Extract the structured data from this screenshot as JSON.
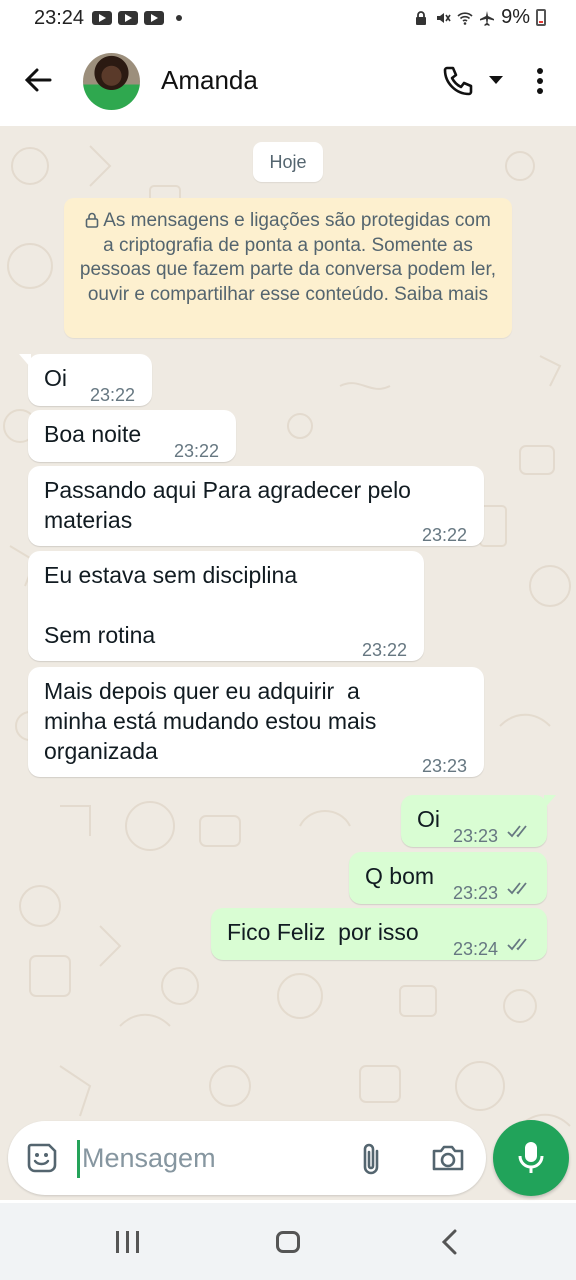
{
  "status_bar": {
    "time": "23:24",
    "battery": "9%",
    "icons": [
      "youtube-icon",
      "youtube-icon",
      "youtube-icon",
      "notification-dot",
      "lock-icon",
      "mute-icon",
      "wifi-icon",
      "airplane-icon",
      "battery-icon"
    ]
  },
  "header": {
    "contact_name": "Amanda",
    "icons": [
      "back-arrow-icon",
      "avatar",
      "phone-icon",
      "chevron-down-icon",
      "more-vert-icon"
    ]
  },
  "chat": {
    "date_chip": "Hoje",
    "encryption_notice": "As mensagens e ligações são protegidas com a criptografia de ponta a ponta. Somente as pessoas que fazem parte da conversa podem ler, ouvir e compartilhar esse conteúdo. Saiba mais",
    "messages": [
      {
        "direction": "incoming",
        "text": "Oi",
        "time": "23:22"
      },
      {
        "direction": "incoming",
        "text": "Boa noite",
        "time": "23:22"
      },
      {
        "direction": "incoming",
        "text": "Passando aqui Para agradecer pelo\nmaterias",
        "time": "23:22"
      },
      {
        "direction": "incoming",
        "text": "Eu estava sem disciplina\n\nSem rotina",
        "time": "23:22"
      },
      {
        "direction": "incoming",
        "text": "Mais depois quer eu adquirir  a\nminha está mudando estou mais\norganizada",
        "time": "23:23"
      },
      {
        "direction": "outgoing",
        "text": "Oi",
        "time": "23:23",
        "status": "read"
      },
      {
        "direction": "outgoing",
        "text": "Q bom",
        "time": "23:23",
        "status": "read"
      },
      {
        "direction": "outgoing",
        "text": "Fico Feliz  por isso",
        "time": "23:24",
        "status": "read"
      }
    ]
  },
  "composer": {
    "placeholder": "Mensagem",
    "value": "",
    "icons": [
      "sticker-icon",
      "attach-icon",
      "camera-icon",
      "mic-icon"
    ]
  },
  "nav_bar": {
    "icons": [
      "recents-icon",
      "home-icon",
      "back-icon"
    ]
  },
  "colors": {
    "chat_background": "#efeae2",
    "incoming_bubble": "#ffffff",
    "outgoing_bubble": "#d9fdd3",
    "encryption_notice_bg": "#fdf0cf",
    "accent_green": "#21a35a",
    "read_ticks": "#667781"
  }
}
